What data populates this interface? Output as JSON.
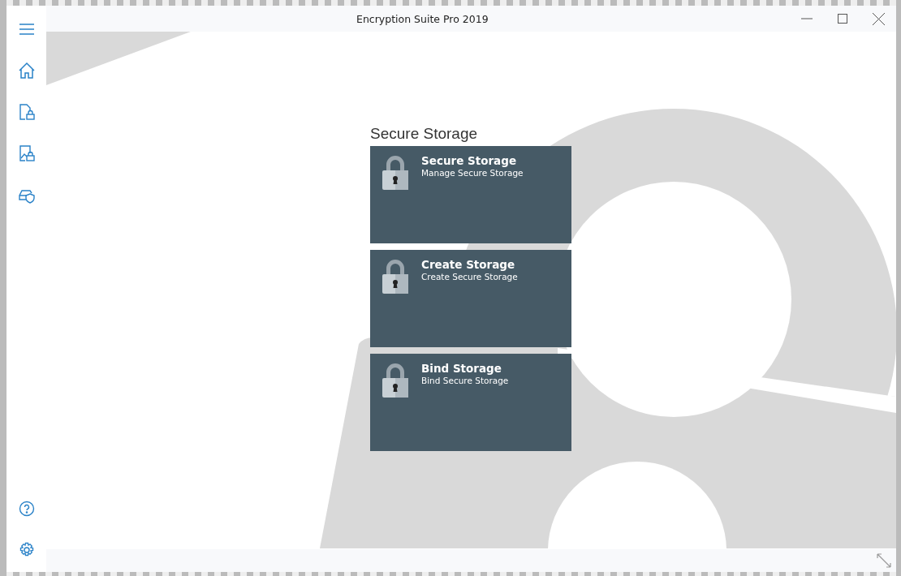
{
  "window": {
    "title": "Encryption Suite Pro 2019"
  },
  "section_title": "Secure Storage",
  "tiles": [
    {
      "title": "Secure Storage",
      "subtitle": "Manage Secure Storage"
    },
    {
      "title": "Create Storage",
      "subtitle": "Create Secure Storage"
    },
    {
      "title": "Bind Storage",
      "subtitle": "Bind Secure Storage"
    }
  ]
}
